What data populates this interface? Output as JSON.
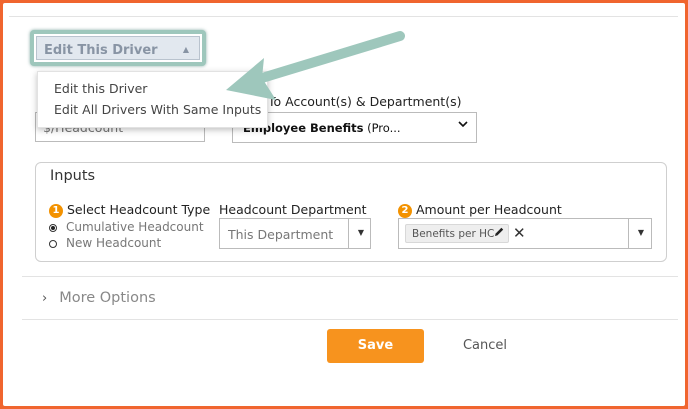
{
  "dropdown": {
    "label": "Edit This Driver",
    "caret": "▲"
  },
  "menu": {
    "items": [
      "Edit this Driver",
      "Edit All Drivers With Same Inputs"
    ]
  },
  "driver_field": {
    "value": "$/Headcount"
  },
  "department": {
    "label": "To Account(s) & Department(s)",
    "select_bold": "Employee Benefits",
    "select_rest": " (Pro...",
    "chevron": "⌄"
  },
  "inputs": {
    "title": "Inputs",
    "headcount_type": {
      "number": "1",
      "label": "Select Headcount Type",
      "options": [
        "Cumulative Headcount",
        "New Headcount"
      ],
      "selected_index": 0
    },
    "headcount_department": {
      "label": "Headcount Department",
      "value": "This Department",
      "caret": "▼"
    },
    "amount": {
      "number": "2",
      "label": "Amount per Headcount",
      "tag": "Benefits per HC",
      "tag_icon": "pencil-icon",
      "clear": "✕",
      "caret": "▼"
    }
  },
  "more_options": {
    "label": "More Options",
    "chevron": "›"
  },
  "footer": {
    "save": "Save",
    "cancel": "Cancel"
  },
  "colors": {
    "accent_orange": "#f7931e",
    "frame_orange": "#f0652f",
    "arrow_teal": "#9ec7bc",
    "badge_orange": "#f39200"
  }
}
